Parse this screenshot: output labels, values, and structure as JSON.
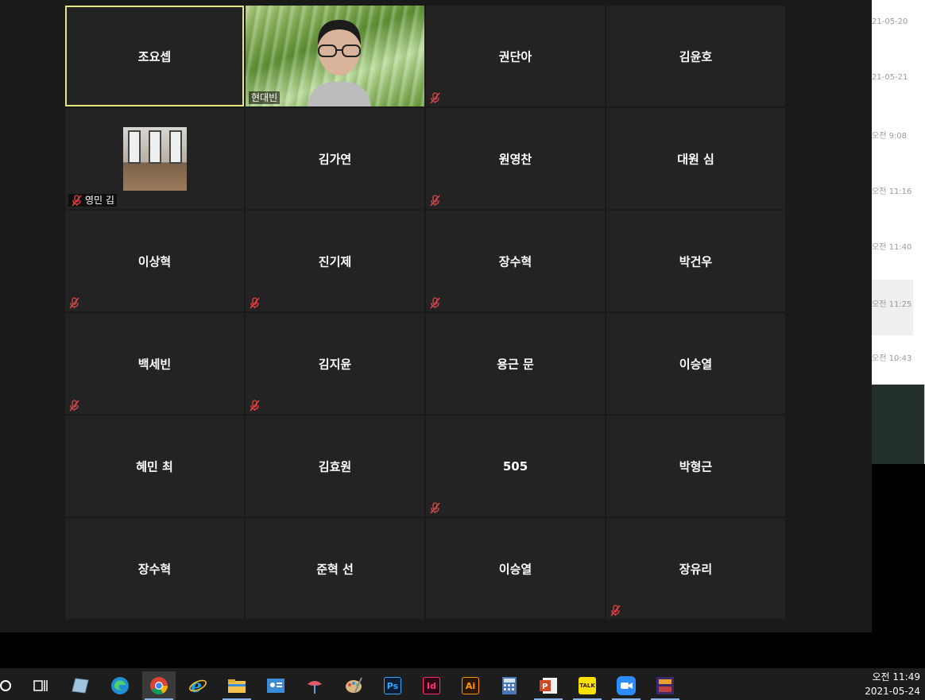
{
  "meeting": {
    "participants": [
      {
        "name": "조요셉",
        "muted": false,
        "video": false,
        "active_speaker": true
      },
      {
        "name": "현대빈",
        "muted": false,
        "video": true
      },
      {
        "name": "권단아",
        "muted": true,
        "video": false
      },
      {
        "name": "김윤호",
        "muted": false,
        "video": false
      },
      {
        "name": "영민 김",
        "muted": true,
        "video": true
      },
      {
        "name": "김가연",
        "muted": false,
        "video": false
      },
      {
        "name": "원영찬",
        "muted": true,
        "video": false
      },
      {
        "name": "대원 심",
        "muted": false,
        "video": false
      },
      {
        "name": "이상혁",
        "muted": true,
        "video": false
      },
      {
        "name": "진기제",
        "muted": true,
        "video": false
      },
      {
        "name": "장수혁",
        "muted": true,
        "video": false
      },
      {
        "name": "박건우",
        "muted": false,
        "video": false
      },
      {
        "name": "백세빈",
        "muted": true,
        "video": false
      },
      {
        "name": "김지윤",
        "muted": true,
        "video": false
      },
      {
        "name": "용근 문",
        "muted": false,
        "video": false
      },
      {
        "name": "이승열",
        "muted": false,
        "video": false
      },
      {
        "name": "혜민 최",
        "muted": false,
        "video": false
      },
      {
        "name": "김효원",
        "muted": false,
        "video": false
      },
      {
        "name": "505",
        "muted": true,
        "video": false
      },
      {
        "name": "박형근",
        "muted": false,
        "video": false
      },
      {
        "name": "장수혁",
        "muted": false,
        "video": false
      },
      {
        "name": "준혁 선",
        "muted": false,
        "video": false
      },
      {
        "name": "이승열",
        "muted": false,
        "video": false
      },
      {
        "name": "장유리",
        "muted": true,
        "video": false
      }
    ]
  },
  "side_panel": {
    "items": [
      "21-05-20",
      "21-05-21",
      "오전 9:08",
      "오전 11:16",
      "오전 11:40",
      "오전 11:25",
      "오전 10:43"
    ]
  },
  "taskbar": {
    "icons": [
      "start-circle-icon",
      "task-view-icon",
      "app-icon",
      "edge-icon",
      "chrome-icon",
      "internet-explorer-icon",
      "file-explorer-icon",
      "contacts-icon",
      "paint-icon",
      "palette-icon",
      "photoshop-icon",
      "indesign-icon",
      "illustrator-icon",
      "calculator-icon",
      "powerpoint-icon",
      "kakaotalk-icon",
      "zoom-icon",
      "game-icon"
    ],
    "ps_label": "Ps",
    "id_label": "Id",
    "ai_label": "Ai",
    "talk_label": "TALK"
  },
  "clock": {
    "time": "오전 11:49",
    "date": "2021-05-24"
  },
  "colors": {
    "active_border": "#e8e87a",
    "mute_red": "#e04444",
    "tile_bg": "#232323"
  }
}
